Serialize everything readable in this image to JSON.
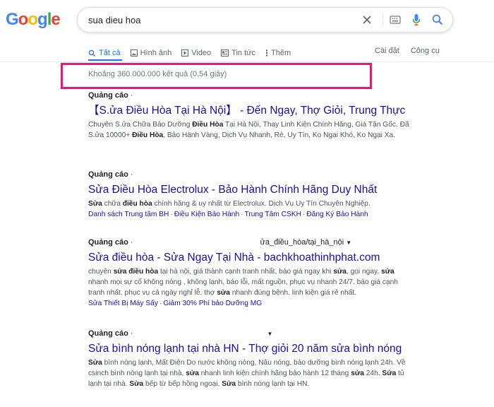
{
  "logo": {
    "letters": [
      {
        "ch": "G",
        "color": "#4285f4"
      },
      {
        "ch": "o",
        "color": "#ea4335"
      },
      {
        "ch": "o",
        "color": "#fbbc05"
      },
      {
        "ch": "g",
        "color": "#4285f4"
      },
      {
        "ch": "l",
        "color": "#34a853"
      },
      {
        "ch": "e",
        "color": "#ea4335"
      }
    ]
  },
  "search": {
    "query": "sua dieu hoa",
    "icons": [
      "close-icon",
      "keyboard-icon",
      "microphone-icon",
      "search-icon"
    ]
  },
  "tabs": [
    {
      "label": "Tất cả",
      "icon": "search-icon",
      "active": true
    },
    {
      "label": "Hình ảnh",
      "icon": "image-icon"
    },
    {
      "label": "Video",
      "icon": "video-icon"
    },
    {
      "label": "Tin tức",
      "icon": "news-icon"
    },
    {
      "label": "Thêm",
      "icon": "more-icon"
    }
  ],
  "tools": {
    "settings": "Cài đặt",
    "tools": "Công cụ"
  },
  "stats": "Khoảng 360.000.000 kết quả (0,54 giây)",
  "colors": {
    "accent": "#1a73e8",
    "link": "#1a0dab",
    "highlight": "#e6197a"
  },
  "ads": [
    {
      "label": "Quảng cáo",
      "url": "",
      "title": "【S.ửa Điều Hòa Tại Hà Nội】 - Đến Ngay, Thợ Giỏi, Trung Thực",
      "desc_html": "Chuyên S.ửa Chữa Bảo Dưỡng <b>Điều Hòa</b> Tại Hà Nội, Thay Linh Kiện Chính Hãng, Giá Tận Gốc. Đã S.ửa 10000+ <b>Điều Hòa</b>, Bảo Hành Vàng, Dịch Vụ Nhanh, Rẻ, Uy Tín, Ko Ngại Khó, Ko Ngại Xa.",
      "sitelinks": []
    },
    {
      "label": "Quảng cáo",
      "url": "",
      "title": "Sửa Điều Hòa Electrolux - Bảo Hành Chính Hãng Duy Nhất",
      "desc_html": "<b>Sửa</b> chữa <b>điều hòa</b> chính hãng & uy nhất từ Electrolux. Dịch Vụ Uy Tín Chuyên Nghiệp.",
      "sitelinks": [
        "Danh sách Trung tâm BH",
        "Điều Kiện Bảo Hành",
        "Trung Tâm CSKH",
        "Đăng Ký Bảo Hành"
      ]
    },
    {
      "label": "Quảng cáo",
      "url": "ửa_điều_hòa/tại_hà_nội",
      "title": "Sửa điều hòa - Sửa Ngay Tại Nhà - bachkhoathinhphat.com",
      "desc_html": "chuyên <b>sửa điều hòa</b> tại hà nội, giá thành cạnh tranh nhất, báo giá ngay khi <b>sửa</b>, gọi ngay. <b>sửa</b> nhanh mọi sự cố không nóng , không lạnh, báo lỗi, mất nguồn, phục vụ nhanh 24/7. báo giá cạnh tranh nhất. phục vụ cả ngày nghỉ lễ. thợ <b>sửa</b> nhanh đúng bệnh. linh kiện giá rẻ nhất.",
      "sitelinks": [
        "Sửa Thiết Bị Máy Sấy",
        "Giảm 30% Phí bảo Dưỡng MG"
      ]
    },
    {
      "label": "Quảng cáo",
      "url": "",
      "title": "Sửa bình nóng lạnh tại nhà HN - Thợ giỏi 20 năm sửa bình nóng",
      "desc_html": "<b>Sửa</b> bình nóng lạnh, Mất Điện Do nước không nóng, Nâu nóng, bảo dưỡng bình nóng lạnh 24h. Về csinch bình nóng lạnh tại nhà, <b>sửa</b> nhanh linh kiện chính hãng bảo hành 12 tháng <b>sửa</b> 24h. <b>Sửa</b> tủ lạnh tại nhà. <b>Sửa</b> bếp từ bếp hồng ngoại. <b>Sửa</b> bình nóng lạnh tại HN.",
      "sitelinks": []
    }
  ]
}
